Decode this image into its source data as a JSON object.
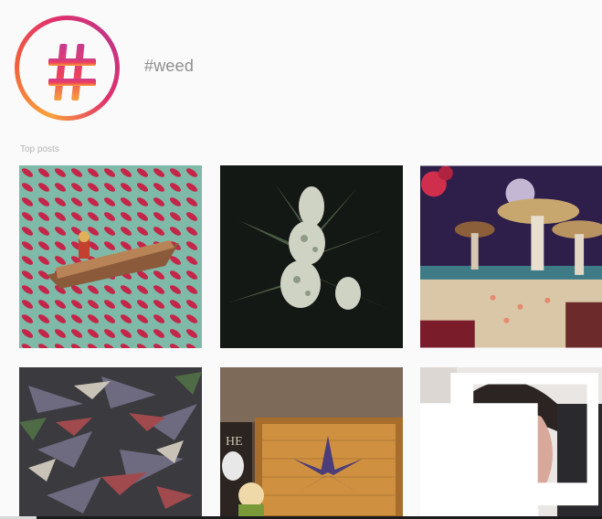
{
  "header": {
    "title": "#weed",
    "icon": "hashtag-icon",
    "gradient_colors": [
      "#f9a13a",
      "#f5603c",
      "#e1306c",
      "#c13584"
    ]
  },
  "section": {
    "label": "Top posts"
  },
  "posts": [
    {
      "description_icon": "op-art-pattern"
    },
    {
      "description_icon": "plant-bud"
    },
    {
      "description_icon": "mushroom-landscape"
    },
    {
      "description_icon": "plant-closeup"
    },
    {
      "description_icon": "wood-sign"
    },
    {
      "description_icon": "portrait",
      "badge": "multiple-posts-icon"
    }
  ]
}
